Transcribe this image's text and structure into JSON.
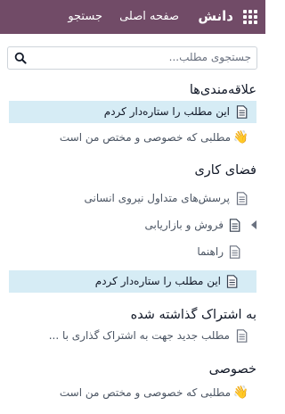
{
  "topbar": {
    "brand": "دانش",
    "nav": [
      "صفحه اصلی",
      "جستجو"
    ]
  },
  "search": {
    "placeholder": "جستجوی مطلب..."
  },
  "sections": {
    "favorites": {
      "title": "علاقه‌مندی‌ها",
      "items": [
        "این مطلب را ستاره‌دار کردم",
        "مطلبی که خصوصی و مختص من است"
      ]
    },
    "workspace": {
      "title": "فضای کاری",
      "items": [
        "پرسش‌های متداول نیروی انسانی",
        "فروش و بازاریابی",
        "راهنما",
        "این مطلب را ستاره‌دار کردم"
      ]
    },
    "shared": {
      "title": "به اشتراک گذاشته شده",
      "items": [
        "مطلب جدید جهت به اشتراک گذاری با ..."
      ]
    },
    "private": {
      "title": "خصوصی",
      "items": [
        "مطلبی که خصوصی و مختص من است"
      ]
    }
  },
  "icons": {
    "apps": "apps-grid-icon",
    "search": "search-icon",
    "article": "document-icon",
    "private_article": "waving-hand-emoji",
    "expand": "caret-left-icon"
  },
  "colors": {
    "topbar": "#714b67",
    "highlight": "#d6ecf5"
  }
}
